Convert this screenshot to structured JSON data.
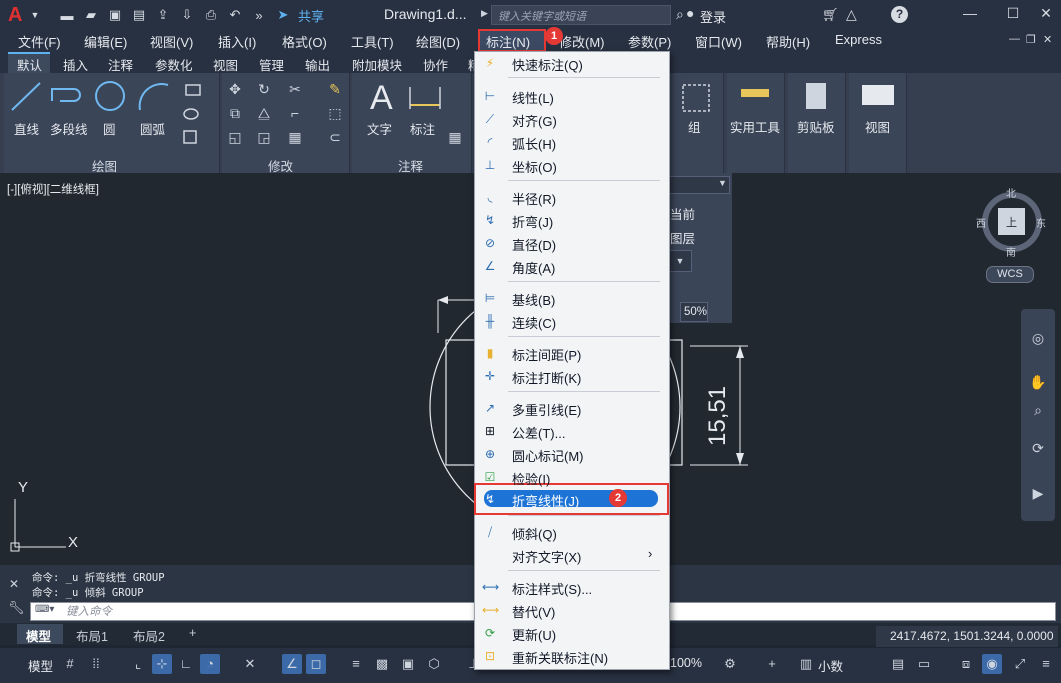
{
  "titlebar": {
    "logo": "A",
    "share": "共享",
    "doc_title": "Drawing1.d...",
    "search_placeholder": "键入关键字或短语",
    "login": "登录"
  },
  "menubar": {
    "items": [
      "文件(F)",
      "编辑(E)",
      "视图(V)",
      "插入(I)",
      "格式(O)",
      "工具(T)",
      "绘图(D)",
      "标注(N)",
      "修改(M)",
      "参数(P)",
      "窗口(W)",
      "帮助(H)",
      "Express"
    ],
    "badge1": "1"
  },
  "ribbon_tabs": [
    "默认",
    "插入",
    "注释",
    "参数化",
    "视图",
    "管理",
    "输出",
    "附加模块",
    "协作",
    "精"
  ],
  "ribbon": {
    "draw_buttons": [
      "直线",
      "多段线",
      "圆",
      "圆弧"
    ],
    "text_buttons": [
      "文字",
      "标注"
    ],
    "right_buttons": [
      "组",
      "实用工具",
      "剪贴板",
      "视图"
    ],
    "panel_labels": [
      "绘图",
      "修改",
      "注释"
    ]
  },
  "canvas": {
    "view_label": "[-][俯视][二维线框]",
    "dimension_text": "15,51",
    "layer_items": [
      "当前",
      "图层"
    ],
    "percent": "50%",
    "compass": {
      "n": "北",
      "s": "南",
      "e": "东",
      "w": "西",
      "top": "上"
    },
    "wcs": "WCS",
    "axis_x": "X",
    "axis_y": "Y"
  },
  "command": {
    "line1": "命令: _u 折弯线性 GROUP",
    "line2": "命令: _u 倾斜 GROUP",
    "placeholder": "键入命令"
  },
  "layout_tabs": [
    "模型",
    "布局1",
    "布局2",
    "+"
  ],
  "coords": "2417.4672, 1501.3244, 0.0000",
  "statusbar": {
    "model": "模型",
    "zoom": "100%",
    "units": "小数"
  },
  "dropdown": {
    "badge2": "2",
    "items": [
      {
        "label": "快速标注(Q)",
        "icon": "quick-dim-icon"
      },
      {
        "label": "线性(L)",
        "icon": "linear-icon"
      },
      {
        "label": "对齐(G)",
        "icon": "aligned-icon"
      },
      {
        "label": "弧长(H)",
        "icon": "arc-length-icon"
      },
      {
        "label": "坐标(O)",
        "icon": "ordinate-icon"
      },
      {
        "label": "半径(R)",
        "icon": "radius-icon"
      },
      {
        "label": "折弯(J)",
        "icon": "jogged-icon"
      },
      {
        "label": "直径(D)",
        "icon": "diameter-icon"
      },
      {
        "label": "角度(A)",
        "icon": "angle-icon"
      },
      {
        "label": "基线(B)",
        "icon": "baseline-icon"
      },
      {
        "label": "连续(C)",
        "icon": "continue-icon"
      },
      {
        "label": "标注间距(P)",
        "icon": "dim-space-icon"
      },
      {
        "label": "标注打断(K)",
        "icon": "dim-break-icon"
      },
      {
        "label": "多重引线(E)",
        "icon": "multileader-icon"
      },
      {
        "label": "公差(T)...",
        "icon": "tolerance-icon"
      },
      {
        "label": "圆心标记(M)",
        "icon": "center-mark-icon"
      },
      {
        "label": "检验(I)",
        "icon": "inspect-icon"
      },
      {
        "label": "折弯线性(J)",
        "icon": "jogged-linear-icon"
      },
      {
        "label": "倾斜(Q)",
        "icon": "oblique-icon"
      },
      {
        "label": "对齐文字(X)",
        "icon": ""
      },
      {
        "label": "标注样式(S)...",
        "icon": "dim-style-icon"
      },
      {
        "label": "替代(V)",
        "icon": "override-icon"
      },
      {
        "label": "更新(U)",
        "icon": "update-icon"
      },
      {
        "label": "重新关联标注(N)",
        "icon": "reassociate-icon"
      }
    ]
  }
}
